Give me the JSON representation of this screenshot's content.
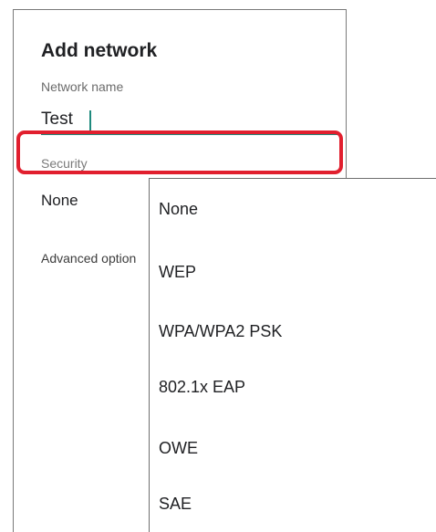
{
  "dialog": {
    "title": "Add network",
    "network_name_label": "Network name",
    "network_name_value": "Test",
    "security_label": "Security",
    "security_value": "None",
    "advanced_options": "Advanced option"
  },
  "security_menu": {
    "options": [
      "None",
      "WEP",
      "WPA/WPA2 PSK",
      "802.1x EAP",
      "OWE",
      "SAE"
    ]
  },
  "colors": {
    "accent": "#1f8a7e",
    "highlight": "#e11f2e"
  }
}
